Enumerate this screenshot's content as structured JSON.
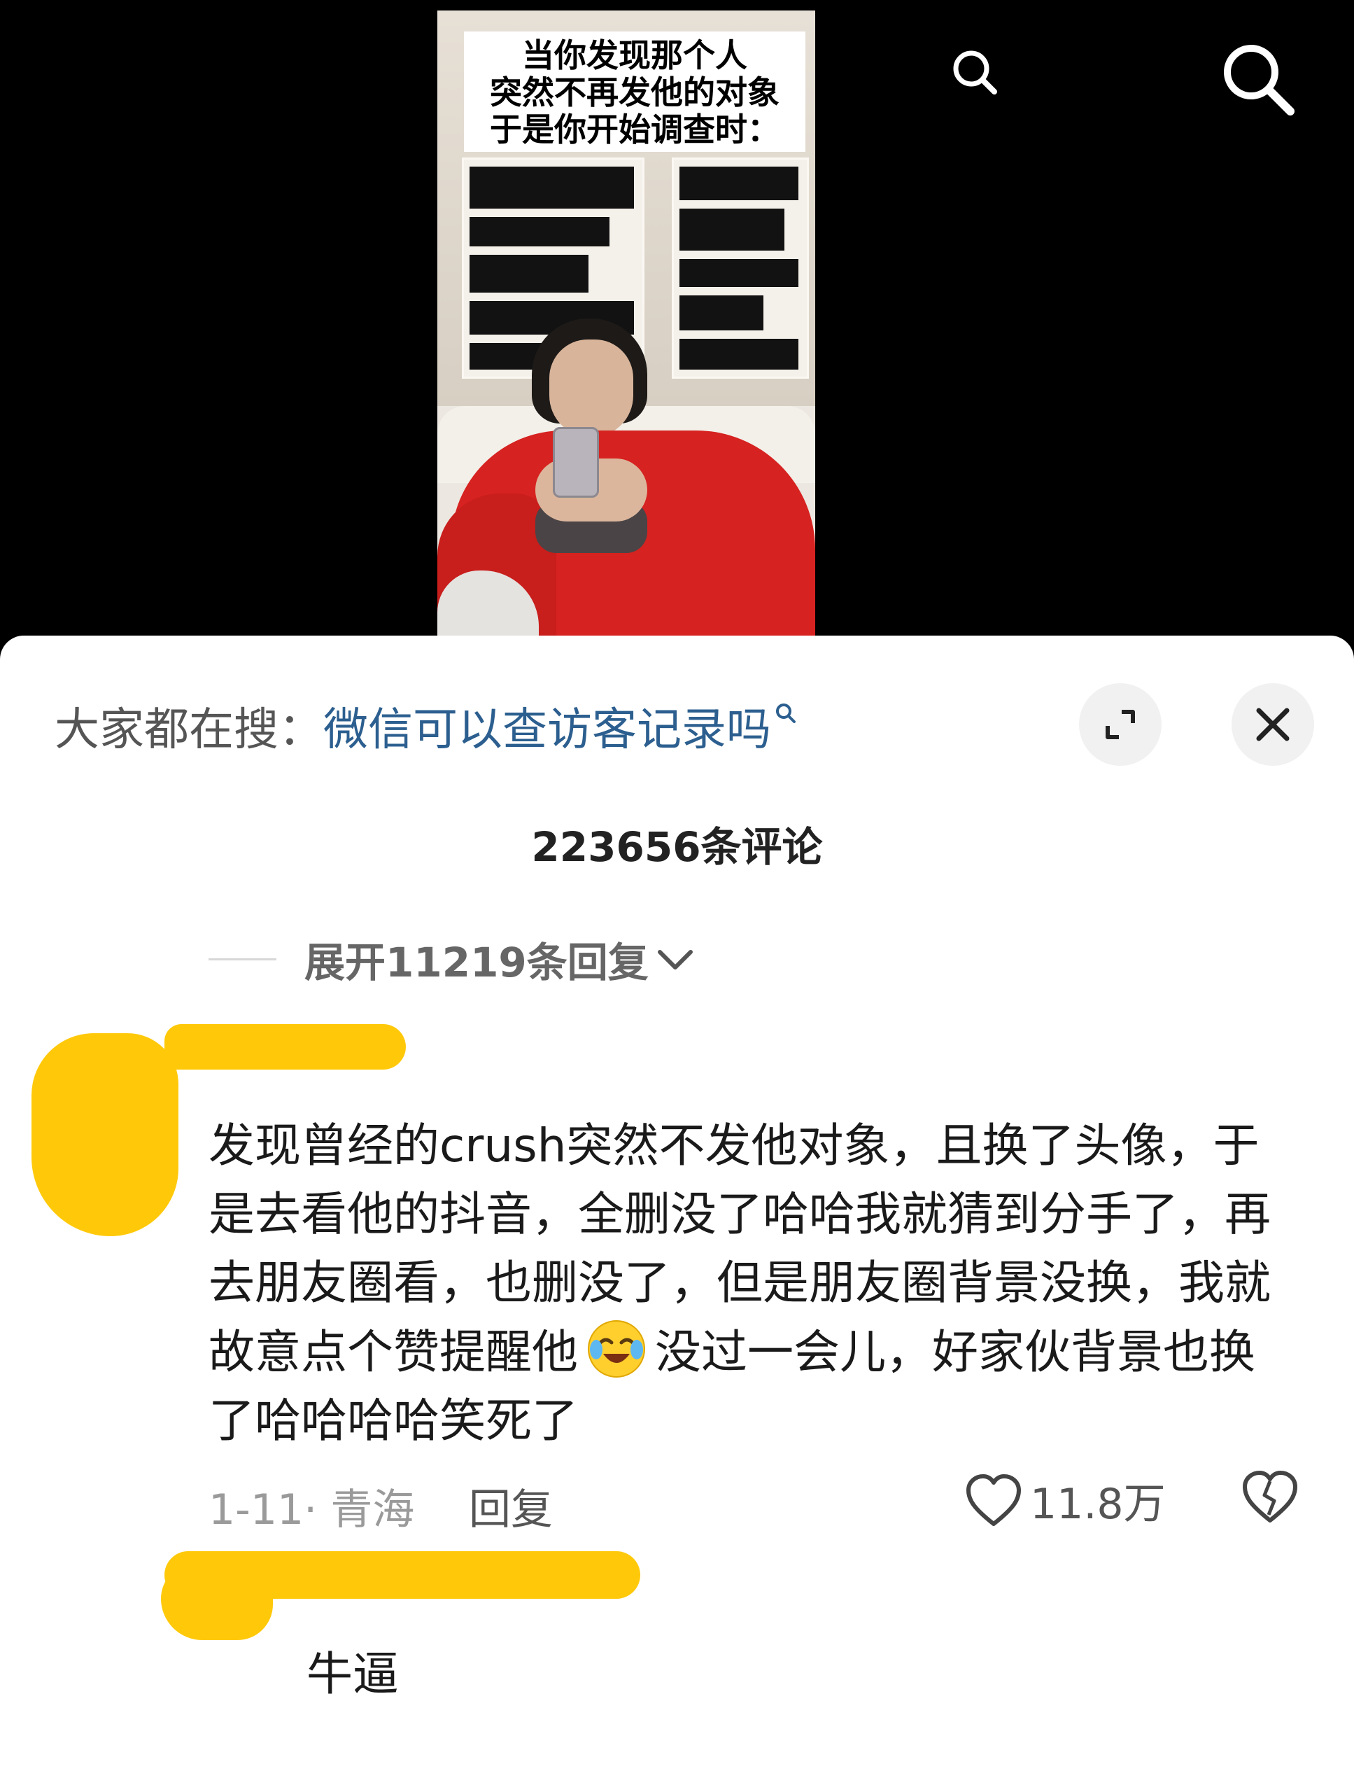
{
  "video": {
    "caption_lines": [
      "当你发现那个人",
      "突然不再发他的对象",
      "于是你开始调查时："
    ]
  },
  "top_bar": {
    "icons": [
      "search-icon",
      "search-icon"
    ]
  },
  "search_suggestion": {
    "prefix": "大家都在搜：",
    "query": "微信可以查访客记录吗",
    "icon": "search-icon"
  },
  "sheet_controls": {
    "expand_icon": "expand-icon",
    "close_icon": "close-icon"
  },
  "comments_header": {
    "count_text": "223656条评论"
  },
  "collapsed_replies": {
    "label": "展开11219条回复",
    "icon": "chevron-down-icon"
  },
  "comment": {
    "text_before_emoji": "发现曾经的crush突然不发他对象，且换了头像，于是去看他的抖音，全删没了哈哈我就猜到分手了，再去朋友圈看，也删没了，但是朋友圈背景没换，我就故意点个赞提醒他",
    "emoji": "crying-laughing-emoji",
    "text_after_emoji": "没过一会儿，好家伙背景也换了哈哈哈哈笑死了",
    "date_location": "1-11· 青海",
    "reply_label": "回复",
    "likes": "11.8万",
    "like_icon": "heart-icon",
    "dislike_icon": "broken-heart-icon"
  },
  "reply": {
    "text": "牛逼"
  },
  "colors": {
    "accent_link": "#2c5f8f",
    "highlighter": "#ffc90a",
    "shirt": "#d62220"
  }
}
